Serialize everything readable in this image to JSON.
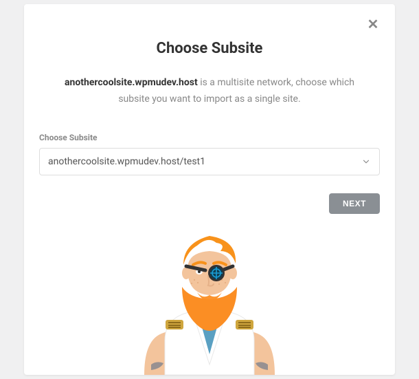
{
  "dialog": {
    "title": "Choose Subsite",
    "desc_bold": "anothercoolsite.wpmudev.host",
    "desc_rest": " is a multisite network, choose which subsite you want to import as a single site."
  },
  "form": {
    "select_label": "Choose Subsite",
    "select_value": "anothercoolsite.wpmudev.host/test1"
  },
  "actions": {
    "next": "NEXT"
  },
  "colors": {
    "hair": "#f8921b",
    "beard": "#fb8e24",
    "skin": "#f3c49c",
    "skinShadow": "#e5b188",
    "coat": "#ffffff",
    "coatEdge": "#e8e8e8",
    "tee": "#5aa0c2",
    "lens": "#1a9ed6",
    "band": "#333333",
    "gold": "#cfa63e",
    "tattoo": "#5c6f8a"
  }
}
